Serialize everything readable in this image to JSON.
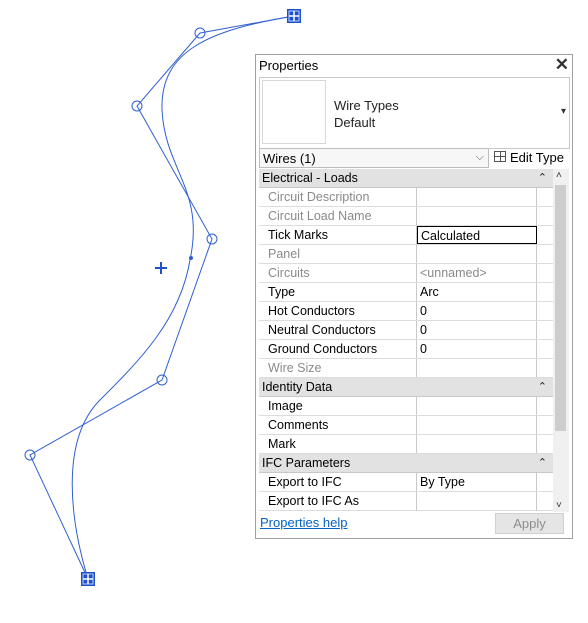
{
  "canvas": {
    "wire_color": "#2f5fd0",
    "grip_color": "#1e50c8"
  },
  "panel": {
    "title": "Properties",
    "close_label": "✕",
    "type_name_line1": "Wire Types",
    "type_name_line2": "Default",
    "type_dropdown_arrow": "▾",
    "filter_value": "Wires (1)",
    "filter_arrow": "⌵",
    "edit_type_label": "Edit Type",
    "help_link": "Properties help",
    "apply_label": "Apply",
    "grid": [
      {
        "kind": "header",
        "label": "Electrical - Loads",
        "collapse": "⌃"
      },
      {
        "kind": "row",
        "label": "Circuit Description",
        "value": "",
        "dim": true
      },
      {
        "kind": "row",
        "label": "Circuit Load Name",
        "value": "",
        "dim": true
      },
      {
        "kind": "row",
        "label": "Tick Marks",
        "value": "Calculated",
        "dim": false,
        "editing": true
      },
      {
        "kind": "row",
        "label": "Panel",
        "value": "",
        "dim": true
      },
      {
        "kind": "row",
        "label": "Circuits",
        "value": "<unnamed>",
        "dim": true
      },
      {
        "kind": "row",
        "label": "Type",
        "value": "Arc",
        "dim": false
      },
      {
        "kind": "row",
        "label": "Hot Conductors",
        "value": "0",
        "dim": false
      },
      {
        "kind": "row",
        "label": "Neutral Conductors",
        "value": "0",
        "dim": false
      },
      {
        "kind": "row",
        "label": "Ground Conductors",
        "value": "0",
        "dim": false
      },
      {
        "kind": "row",
        "label": "Wire Size",
        "value": "",
        "dim": true
      },
      {
        "kind": "header",
        "label": "Identity Data",
        "collapse": "⌃"
      },
      {
        "kind": "row",
        "label": "Image",
        "value": "",
        "dim": false
      },
      {
        "kind": "row",
        "label": "Comments",
        "value": "",
        "dim": false
      },
      {
        "kind": "row",
        "label": "Mark",
        "value": "",
        "dim": false
      },
      {
        "kind": "header",
        "label": "IFC Parameters",
        "collapse": "⌃"
      },
      {
        "kind": "row",
        "label": "Export to IFC",
        "value": "By Type",
        "dim": false
      },
      {
        "kind": "row",
        "label": "Export to IFC As",
        "value": "",
        "dim": false
      }
    ],
    "scroll_up": "˄",
    "scroll_down": "˅"
  }
}
